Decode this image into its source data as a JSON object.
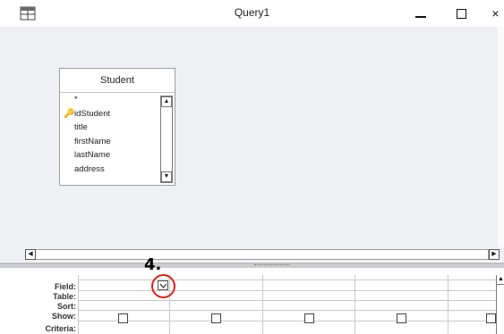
{
  "window": {
    "title": "Query1",
    "controls": {
      "minimize": "minimize-icon",
      "maximize": "maximize-icon",
      "close": "×"
    }
  },
  "table": {
    "name": "Student",
    "fields": [
      "*",
      "idStudent",
      "title",
      "firstName",
      "lastName",
      "address"
    ],
    "primary_key": "idStudent"
  },
  "grid": {
    "row_labels": [
      "Field:",
      "Table:",
      "Sort:",
      "Show:",
      "Criteria:"
    ],
    "columns": 5
  },
  "annotation": {
    "label": "4.",
    "accent_color": "#e0201b"
  }
}
